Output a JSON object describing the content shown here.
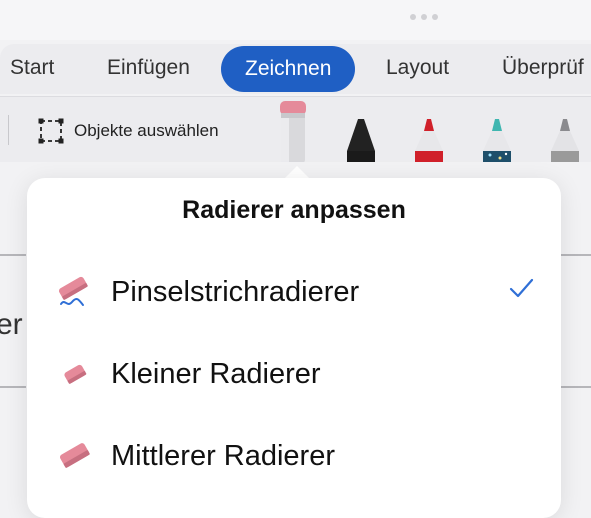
{
  "ribbon": {
    "tabs": [
      {
        "label": "Start",
        "active": false
      },
      {
        "label": "Einfügen",
        "active": false
      },
      {
        "label": "Zeichnen",
        "active": true
      },
      {
        "label": "Layout",
        "active": false
      },
      {
        "label": "Überprüf",
        "active": false
      }
    ],
    "accent_color": "#1f5fc4"
  },
  "toolbar": {
    "select_objects_label": "Objekte auswählen",
    "tools": [
      {
        "name": "eraser-icon",
        "selected": true,
        "color": "#e58a9a"
      },
      {
        "name": "pen-black-icon",
        "color": "#1a1a1a"
      },
      {
        "name": "pen-red-icon",
        "color": "#d0202a"
      },
      {
        "name": "pen-galaxy-icon",
        "color": "#3fb6b0"
      },
      {
        "name": "pencil-gray-icon",
        "color": "#9a9a9a"
      }
    ]
  },
  "document": {
    "peek_text": "er"
  },
  "popover": {
    "title": "Radierer anpassen",
    "options": [
      {
        "label": "Pinselstrichradierer",
        "icon": "stroke-eraser-icon",
        "checked": true
      },
      {
        "label": "Kleiner Radierer",
        "icon": "small-eraser-icon",
        "checked": false
      },
      {
        "label": "Mittlerer Radierer",
        "icon": "medium-eraser-icon",
        "checked": false
      }
    ],
    "check_color": "#2f6fd6"
  }
}
